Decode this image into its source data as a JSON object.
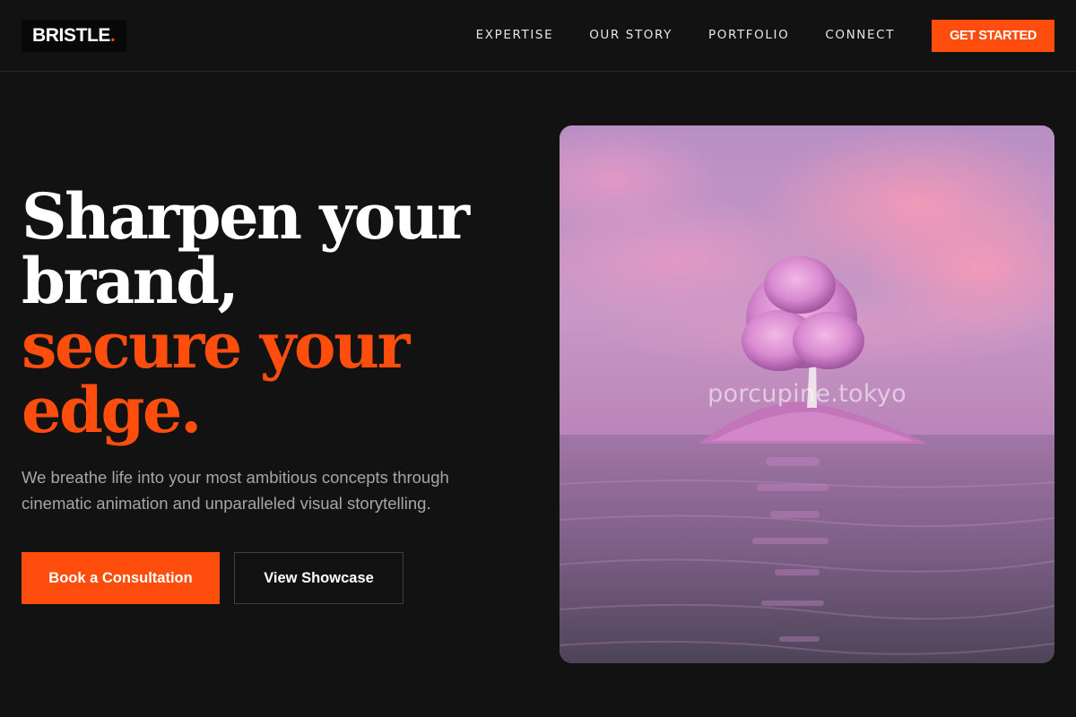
{
  "brand": {
    "name": "BRISTLE",
    "dot": ".",
    "accent_color": "#ff4d0d"
  },
  "nav": {
    "items": [
      {
        "label": "EXPERTISE"
      },
      {
        "label": "OUR STORY"
      },
      {
        "label": "PORTFOLIO"
      },
      {
        "label": "CONNECT"
      }
    ],
    "cta_label": "GET STARTED"
  },
  "hero": {
    "headline_lines": [
      "Sharpen your",
      "brand,"
    ],
    "headline_accent_lines": [
      "secure your",
      "edge."
    ],
    "subtext": "We breathe life into your most ambitious concepts through cinematic animation and unparalleled visual storytelling.",
    "primary_button": "Book a Consultation",
    "secondary_button": "View Showcase"
  },
  "image": {
    "watermark": "porcupine.tokyo",
    "subject": "pink-tree-island-in-water"
  },
  "colors": {
    "background": "#121212",
    "accent": "#ff4d0d",
    "text": "#ffffff",
    "muted_text": "#a6a6a6"
  }
}
